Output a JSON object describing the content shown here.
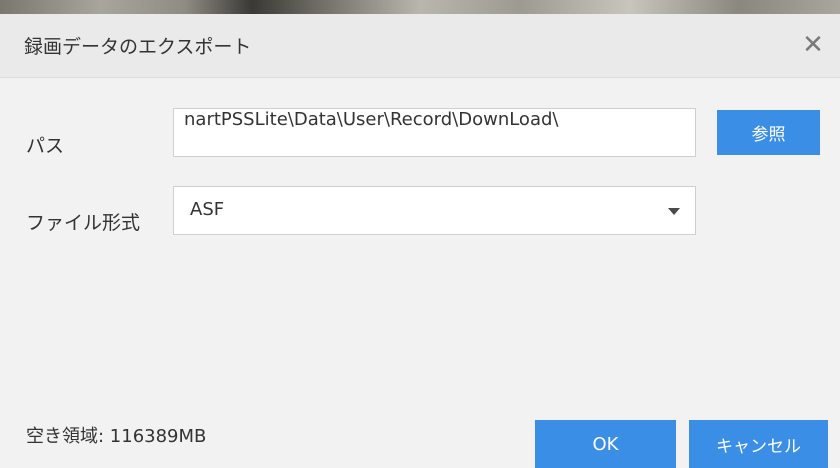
{
  "dialog": {
    "title": "録画データのエクスポート",
    "close_icon": "close-icon",
    "close_glyph": "✕"
  },
  "form": {
    "path_label": "パス",
    "path_value": "nartPSSLite\\Data\\User\\Record\\DownLoad\\",
    "browse_label": "参照",
    "format_label": "ファイル形式",
    "format_value": "ASF",
    "dropdown_icon": "dropdown-arrow-icon"
  },
  "footer": {
    "free_space": "空き領域: 116389MB",
    "ok_label": "OK",
    "cancel_label": "キャンセル"
  },
  "colors": {
    "accent": "#3a8ee6",
    "background": "#f2f2f2",
    "titlebar": "#eaeaea",
    "text": "#333333"
  }
}
